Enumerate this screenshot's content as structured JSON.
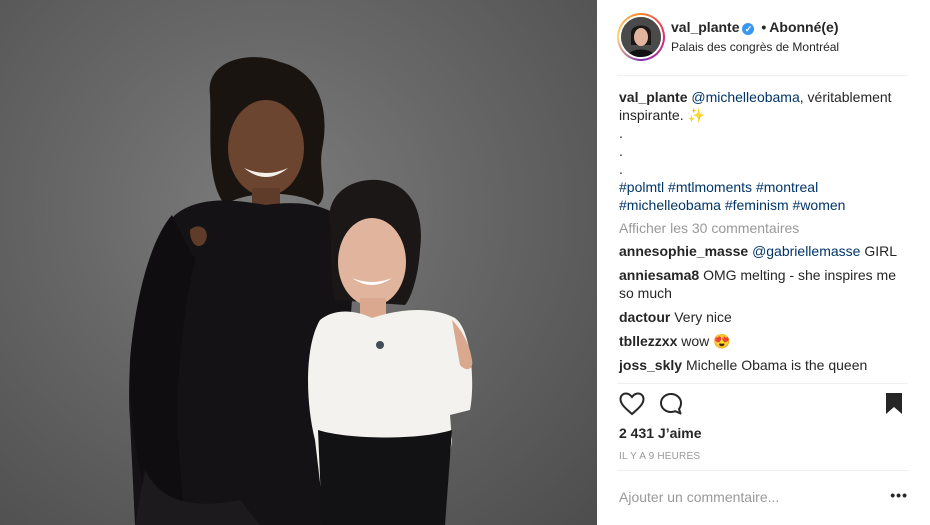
{
  "post": {
    "username": "val_plante",
    "verified_glyph": "✓",
    "separator": "•",
    "follow_state": "Abonné(e)",
    "location": "Palais des congrès de Montréal"
  },
  "caption": {
    "username": "val_plante",
    "mention": "@michelleobama",
    "text": ", véritablement inspirante.",
    "emoji": "✨",
    "dots": [
      ".",
      ".",
      "."
    ],
    "hashtags_line1": [
      "#polmtl",
      "#mtlmoments",
      "#montreal"
    ],
    "hashtags_line2": [
      "#michelleobama",
      "#feminism",
      "#women"
    ]
  },
  "view_all_comments": "Afficher les 30 commentaires",
  "comments": [
    {
      "username": "annesophie_masse",
      "mention": "@gabriellemasse",
      "text": " GIRL"
    },
    {
      "username": "anniesama8",
      "text": "OMG melting - she inspires me so much"
    },
    {
      "username": "dactour",
      "text": "Very nice"
    },
    {
      "username": "tbllezzxx",
      "text": "wow 😍"
    },
    {
      "username": "joss_skly",
      "text": "Michelle Obama is the queen"
    }
  ],
  "actions": {
    "like_icon": "heart-icon",
    "comment_icon": "comment-icon",
    "save_icon": "bookmark-icon"
  },
  "likes": "2 431 J’aime",
  "timestamp": "IL Y A 9 HEURES",
  "add_comment_placeholder": "Ajouter un commentaire...",
  "more_label": "•••",
  "colors": {
    "link": "#003569",
    "muted": "#999999",
    "verified": "#3897f0",
    "text": "#262626"
  }
}
